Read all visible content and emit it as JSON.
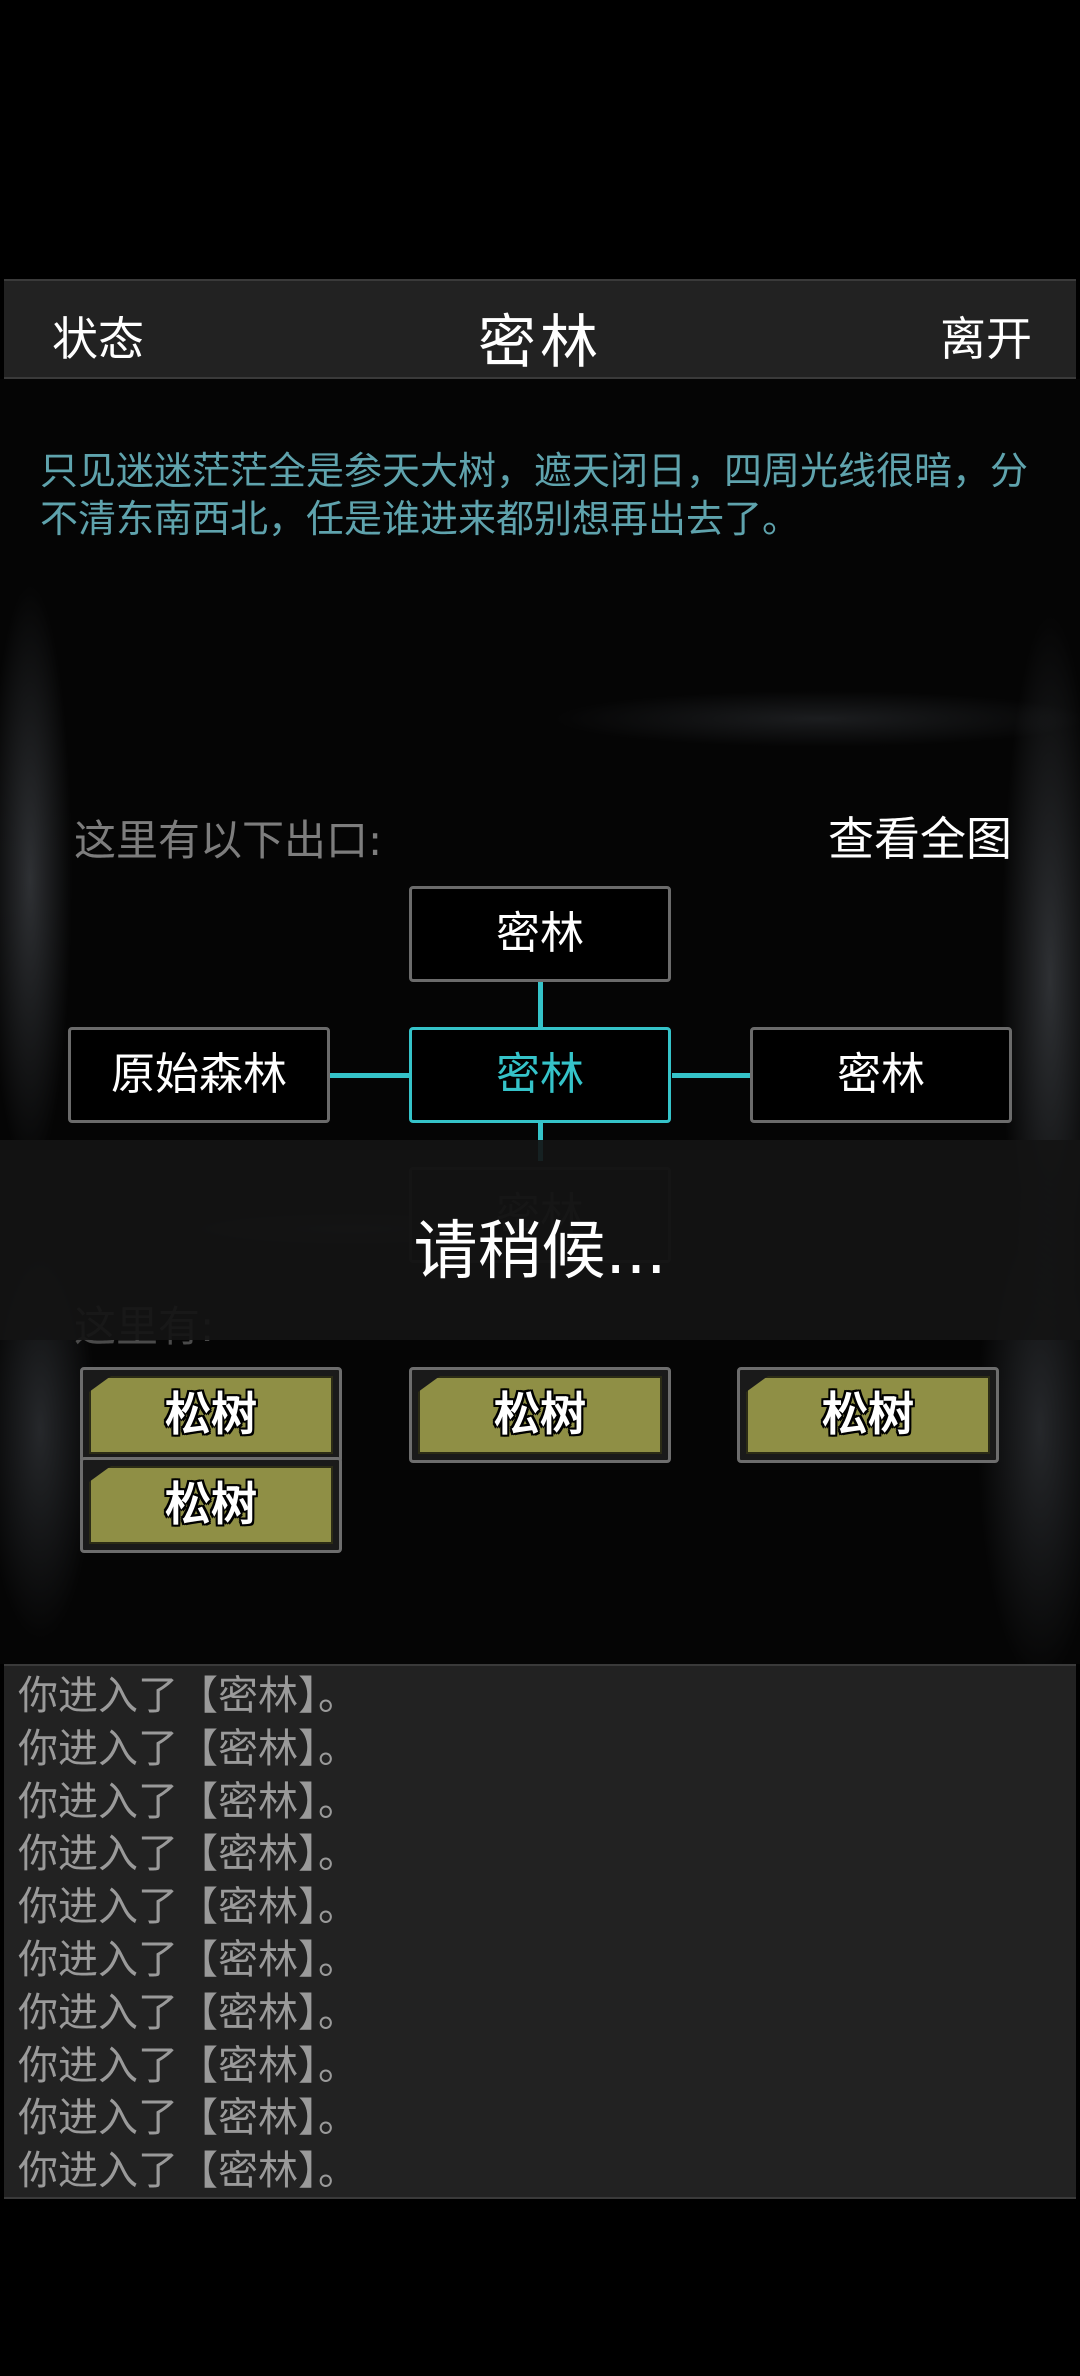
{
  "header": {
    "left_button": "状态",
    "title": "密林",
    "right_button": "离开"
  },
  "scene": {
    "description": "只见迷迷茫茫全是参天大树，遮天闭日，四周光线很暗，分不清东南西北，任是谁进来都别想再出去了。",
    "exits_label": "这里有以下出口:",
    "view_map": "查看全图",
    "exits": {
      "north": "密林",
      "west": "原始森林",
      "center": "密林",
      "east": "密林",
      "south": "密林"
    },
    "here_label": "这里有:",
    "items": [
      "松树",
      "松树",
      "松树",
      "松树"
    ]
  },
  "loading": {
    "text": "请稍候..."
  },
  "log": {
    "lines": [
      "你进入了【密林】。",
      "你进入了【密林】。",
      "你进入了【密林】。",
      "你进入了【密林】。",
      "你进入了【密林】。",
      "你进入了【密林】。",
      "你进入了【密林】。",
      "你进入了【密林】。",
      "你进入了【密林】。",
      "你进入了【密林】。"
    ]
  },
  "colors": {
    "accent": "#35c3c9",
    "description": "#5fa3ad",
    "item": "#8f8f45"
  }
}
